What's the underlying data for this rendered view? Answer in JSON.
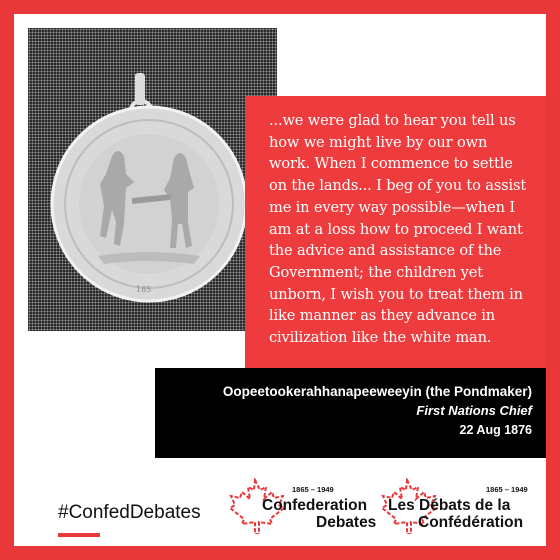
{
  "quote": {
    "text": "...we were glad to hear you tell us how we might live by our own work. When I commence to settle on the lands... I beg of you to assist me in every way possible—when I am at a loss how to proceed I want the advice and assistance of the Government; the children yet unborn, I wish you to treat them in like manner as they advance in civilization like the white man."
  },
  "attribution": {
    "name": "Oopeetookerahhanapeeweeyin (the Pondmaker)",
    "role": "First Nations Chief",
    "date": "22 Aug 1876"
  },
  "footer": {
    "hashtag": "#ConfedDebates",
    "logo_en": {
      "years": "1865 – 1949",
      "line1": "Confederation",
      "line2": "Debates"
    },
    "logo_fr": {
      "years": "1865 – 1949",
      "line1": "Les Débats de la",
      "line2": "Confédération"
    }
  },
  "colors": {
    "accent": "#e8383a",
    "bar": "#000000",
    "background": "#ffffff"
  }
}
